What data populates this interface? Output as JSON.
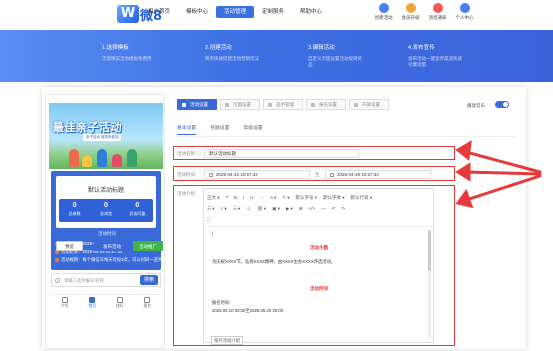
{
  "header": {
    "logo_mark": "W",
    "logo_text": "微8",
    "nav": [
      "用户首页",
      "模板中心",
      "活动管理",
      "定制服务",
      "帮助中心"
    ],
    "nav_active": 2,
    "icons": [
      {
        "name": "create-activity-icon",
        "label": "创建活动",
        "color": "#4a7ff0"
      },
      {
        "name": "member-upgrade-icon",
        "label": "会员升级",
        "color": "#f3a33b"
      },
      {
        "name": "message-notice-icon",
        "label": "消息通知",
        "color": "#ef5b5b"
      },
      {
        "name": "personal-center-icon",
        "label": "个人中心",
        "color": "#4a7ff0"
      }
    ]
  },
  "steps": [
    {
      "title": "1.选择模板",
      "desc": "丰富精美活动模板免费用"
    },
    {
      "title": "2.创建活动",
      "desc": "简单快速搭建活动营销玩法"
    },
    {
      "title": "3.编辑活动",
      "desc": "自定义页面设置活动规则奖品"
    },
    {
      "title": "4.发布宣传",
      "desc": "发布活动一键宣传渠道快速引爆流量"
    }
  ],
  "preview": {
    "banner_title": "最佳亲子活动",
    "banner_sub": "亲子活动 邀您来参加",
    "title": "默认活动标题",
    "stats": [
      {
        "n": "0",
        "l": "总参数"
      },
      {
        "n": "0",
        "l": "总浏览"
      },
      {
        "n": "0",
        "l": "总访问量"
      }
    ],
    "info_heading": "活动时间",
    "info_rows": [
      "活动开始：2025-04-22 10:57:34",
      "活动结束：2025-04-29 10:57:34",
      "活动规则：每个微信号每天可投3次，可以对同一选手投多次"
    ],
    "search_placeholder": "请输入选手编号/名称",
    "search_button": "搜索",
    "tabbar": [
      "介绍",
      "首页",
      "排行",
      "报名"
    ],
    "tabbar_active": 1,
    "buttons": [
      {
        "label": "预览",
        "bg": "#ffffff",
        "fg": "#333333",
        "border": "#cccccc"
      },
      {
        "label": "发布活动",
        "bg": "#3a69d8",
        "fg": "#ffffff",
        "border": "#3a69d8"
      },
      {
        "label": "活动推广",
        "bg": "#3bb54a",
        "fg": "#ffffff",
        "border": "#3bb54a"
      }
    ]
  },
  "form": {
    "subtabs": [
      "活动设置",
      "页面设置",
      "选手管理",
      "报名设置",
      "开屏设置"
    ],
    "subtab_active": 0,
    "toggle_label": "播放音乐",
    "ftabs": [
      "基本设置",
      "奖励设置",
      "高级设置"
    ],
    "ftab_active": 0,
    "name_label": "活动名称 ⓘ",
    "name_value": "默认活动标题",
    "time_label": "活动时间",
    "start": "2025-04-22 10:57:34",
    "sep": "至",
    "end": "2025-04-29 10:57:34",
    "intro_label": "活动介绍",
    "toolbar_row1": [
      "正文 ▾",
      "❝",
      "B",
      "I",
      "U",
      "···",
      "A ▾",
      "✎ ▾",
      "默认字号 ▾",
      "默认字体 ▾",
      "默认行高 ▾"
    ],
    "toolbar_row2": [
      "☰ ▾",
      "≡ ▾",
      "☷ ▾",
      "☺",
      "⛓ ▾",
      "▣ ▾",
      "▶ ▾",
      "⊞",
      "</>",
      "—",
      "↶",
      "↷"
    ],
    "toolbar_row3": [
      "⛶"
    ],
    "content": {
      "cursor": "|",
      "h1": "活动主题",
      "p1": "为庆祝XXXX节，弘扬XXXX精神，由XXXX主办XXXX评选活动。",
      "h2": "活动时间",
      "p2": "报名时间：",
      "p3": "2025.05.10 00:00至2025.05.20 20:00"
    },
    "save_button": "保存活动介绍"
  },
  "accent": "#3a69d8",
  "highlight_color": "#e53a3a"
}
